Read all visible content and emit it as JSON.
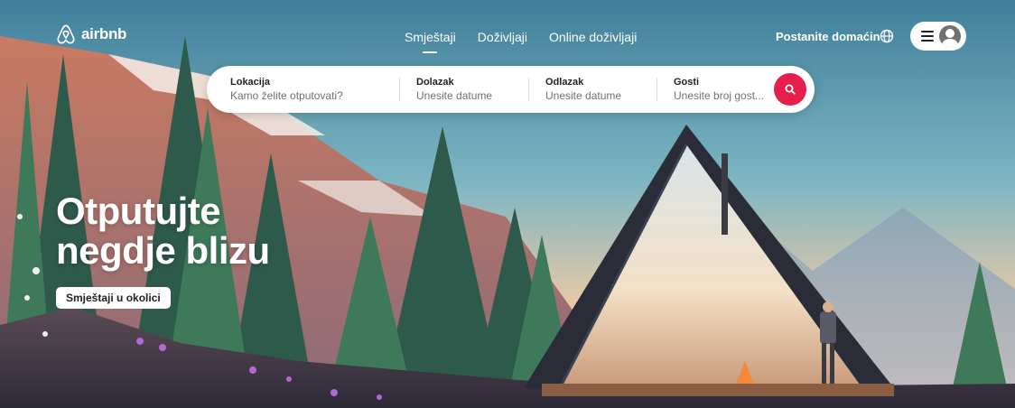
{
  "brand": {
    "name": "airbnb",
    "accent": "#E61E4D"
  },
  "nav": {
    "tabs": [
      {
        "label": "Smještaji",
        "active": true
      },
      {
        "label": "Doživljaji",
        "active": false
      },
      {
        "label": "Online doživljaji",
        "active": false
      }
    ],
    "host_link": "Postanite domaćin",
    "globe_icon": "globe-icon",
    "menu_icon": "hamburger-menu-icon",
    "avatar_icon": "user-avatar-icon"
  },
  "search": {
    "location": {
      "label": "Lokacija",
      "placeholder": "Kamo želite otputovati?"
    },
    "checkin": {
      "label": "Dolazak",
      "placeholder": "Unesite datume"
    },
    "checkout": {
      "label": "Odlazak",
      "placeholder": "Unesite datume"
    },
    "guests": {
      "label": "Gosti",
      "placeholder": "Unesite broj gost..."
    },
    "button_icon": "search-icon"
  },
  "hero": {
    "headline_line1": "Otputujte",
    "headline_line2": "negdje blizu",
    "cta_label": "Smještaji u okolici"
  }
}
